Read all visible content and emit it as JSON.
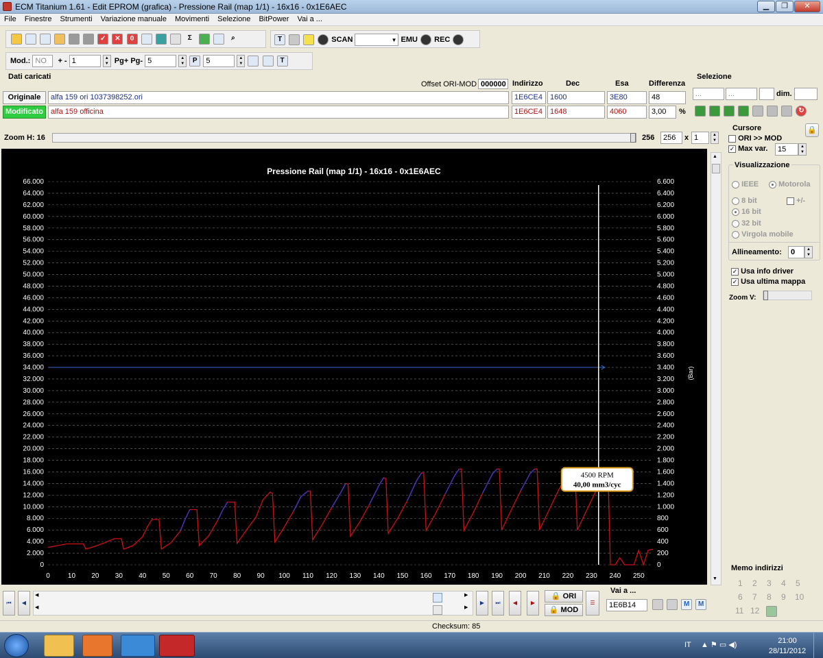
{
  "window": {
    "title": "ECM Titanium 1.61 - Edit EPROM (grafica) - Pressione Rail (map 1/1) - 16x16 - 0x1E6AEC",
    "minimize": "▁",
    "maximize": "❐",
    "close": "✕"
  },
  "menu": [
    "File",
    "Finestre",
    "Strumenti",
    "Variazione manuale",
    "Movimenti",
    "Selezione",
    "BitPower",
    "Vai a ..."
  ],
  "toolbar1": {
    "scan_label": "SCAN",
    "scan_value": "",
    "emu_label": "EMU",
    "rec_label": "REC"
  },
  "toolbar2": {
    "mod_label": "Mod.:",
    "mod_value": "NO",
    "plusminus_label": "+ -",
    "plusminus_value": "1",
    "pg_label": "Pg+ Pg-",
    "pg_value": "5",
    "p_value": "5"
  },
  "dati": {
    "header": "Dati caricati",
    "offset_label": "Offset ORI-MOD",
    "offset_value": "000000",
    "col_indirizzo": "Indirizzo",
    "col_dec": "Dec",
    "col_esa": "Esa",
    "col_diff": "Differenza",
    "originale": {
      "label": "Originale",
      "name": "alfa 159  ori 1037398252.ori",
      "indirizzo": "1E6CE4",
      "dec": "1600",
      "esa": "3E80",
      "diff": "48"
    },
    "modificato": {
      "label": "Modificato",
      "name": "alfa 159 officina",
      "indirizzo": "1E6CE4",
      "dec": "1648",
      "esa": "4060",
      "diff": "3,00",
      "pct": "%"
    }
  },
  "selezione": {
    "header": "Selezione",
    "field1": "...",
    "field2": "...",
    "dim_label": "dim."
  },
  "zoom": {
    "label": "Zoom H: 16",
    "v1": "256",
    "v2": "256",
    "x": "x",
    "mult": "1"
  },
  "cursore": {
    "header": "Cursore",
    "ori_mod": "ORI >> MOD",
    "max_var_label": "Max var.",
    "max_var_value": "15"
  },
  "visualizzazione": {
    "header": "Visualizzazione",
    "ieee": "IEEE",
    "motorola": "Motorola",
    "bit8": "8 bit",
    "plusminus": "+/-",
    "bit16": "16 bit",
    "bit32": "32 bit",
    "virgola": "Virgola mobile",
    "allineamento_label": "Allineamento:",
    "allineamento_value": "0",
    "usa_info": "Usa info driver",
    "usa_ultima": "Usa ultima mappa",
    "zoom_v": "Zoom V:"
  },
  "memo": {
    "header": "Memo indirizzi",
    "numbers": [
      "1",
      "2",
      "3",
      "4",
      "5",
      "6",
      "7",
      "8",
      "9",
      "10",
      "11",
      "12"
    ]
  },
  "bottom": {
    "ori_btn": "ORI",
    "mod_btn": "MOD",
    "vai_label": "Vai a ...",
    "vai_value": "1E6B14"
  },
  "status": {
    "checksum": "Checksum: 85"
  },
  "taskbar": {
    "lang": "IT",
    "time": "21:00",
    "date": "28/11/2012"
  },
  "chart_data": {
    "type": "line",
    "title": "Pressione Rail (map 1/1) - 16x16 - 0x1E6AEC",
    "xlabel": "",
    "ylabel_left": "",
    "ylabel_right": "(Bar)",
    "xlim": [
      0,
      256
    ],
    "ylim_left": [
      0,
      66000
    ],
    "ylim_right": [
      0,
      6600
    ],
    "xticks": [
      0,
      10,
      20,
      30,
      40,
      50,
      60,
      70,
      80,
      90,
      100,
      110,
      120,
      130,
      140,
      150,
      160,
      170,
      180,
      190,
      200,
      210,
      220,
      230,
      240,
      250
    ],
    "yticks_left": [
      "0",
      "2.000",
      "4.000",
      "6.000",
      "8.000",
      "10.000",
      "12.000",
      "14.000",
      "16.000",
      "18.000",
      "20.000",
      "22.000",
      "24.000",
      "26.000",
      "28.000",
      "30.000",
      "32.000",
      "34.000",
      "36.000",
      "38.000",
      "40.000",
      "42.000",
      "44.000",
      "46.000",
      "48.000",
      "50.000",
      "52.000",
      "54.000",
      "56.000",
      "58.000",
      "60.000",
      "62.000",
      "64.000",
      "66.000"
    ],
    "yticks_right": [
      "0",
      "200",
      "400",
      "600",
      "800",
      "1.000",
      "1.200",
      "1.400",
      "1.600",
      "1.800",
      "2.000",
      "2.200",
      "2.400",
      "2.600",
      "2.800",
      "3.000",
      "3.200",
      "3.400",
      "3.600",
      "3.800",
      "4.000",
      "4.200",
      "4.400",
      "4.600",
      "4.800",
      "5.000",
      "5.200",
      "5.400",
      "5.600",
      "5.800",
      "6.000",
      "6.200",
      "6.400",
      "6.600"
    ],
    "grid": true,
    "cursor": {
      "x": 233,
      "rpm": "4500 RPM",
      "qty": "40,00 mm3/cyc"
    },
    "hline": {
      "y": 34000
    },
    "series": [
      {
        "color": "#d01010",
        "points": [
          [
            0,
            3000
          ],
          [
            4,
            3300
          ],
          [
            8,
            3600
          ],
          [
            12,
            3600
          ],
          [
            15,
            3600
          ],
          [
            16,
            2700
          ],
          [
            20,
            3200
          ],
          [
            24,
            3800
          ],
          [
            28,
            4500
          ],
          [
            31,
            4500
          ],
          [
            32,
            2700
          ],
          [
            36,
            3300
          ],
          [
            40,
            4800
          ],
          [
            42,
            6500
          ],
          [
            44,
            7800
          ],
          [
            47,
            7800
          ],
          [
            48,
            2700
          ],
          [
            52,
            3800
          ],
          [
            56,
            5800
          ],
          [
            58,
            7800
          ],
          [
            60,
            9500
          ],
          [
            63,
            9500
          ],
          [
            64,
            3300
          ],
          [
            68,
            5000
          ],
          [
            72,
            7800
          ],
          [
            74,
            9500
          ],
          [
            76,
            10800
          ],
          [
            79,
            10800
          ],
          [
            80,
            3700
          ],
          [
            84,
            6000
          ],
          [
            88,
            8200
          ],
          [
            91,
            11200
          ],
          [
            94,
            12500
          ],
          [
            95,
            12300
          ],
          [
            96,
            3900
          ],
          [
            100,
            6500
          ],
          [
            104,
            9300
          ],
          [
            107,
            11700
          ],
          [
            110,
            12700
          ],
          [
            111,
            12700
          ],
          [
            112,
            4300
          ],
          [
            116,
            6900
          ],
          [
            120,
            9800
          ],
          [
            124,
            12500
          ],
          [
            126,
            14000
          ],
          [
            127,
            13900
          ],
          [
            128,
            4900
          ],
          [
            132,
            7400
          ],
          [
            136,
            10400
          ],
          [
            140,
            13600
          ],
          [
            142,
            15000
          ],
          [
            143,
            14800
          ],
          [
            144,
            5400
          ],
          [
            148,
            8000
          ],
          [
            152,
            11000
          ],
          [
            156,
            14500
          ],
          [
            158,
            15800
          ],
          [
            159,
            15800
          ],
          [
            160,
            5900
          ],
          [
            164,
            8800
          ],
          [
            168,
            12100
          ],
          [
            172,
            15300
          ],
          [
            174,
            16500
          ],
          [
            175,
            16500
          ],
          [
            176,
            5900
          ],
          [
            180,
            9000
          ],
          [
            184,
            12400
          ],
          [
            188,
            15600
          ],
          [
            190,
            16500
          ],
          [
            191,
            16500
          ],
          [
            192,
            6000
          ],
          [
            196,
            9400
          ],
          [
            200,
            12700
          ],
          [
            204,
            15700
          ],
          [
            206,
            16500
          ],
          [
            207,
            16500
          ],
          [
            208,
            6000
          ],
          [
            212,
            9400
          ],
          [
            216,
            12800
          ],
          [
            220,
            15700
          ],
          [
            222,
            16500
          ],
          [
            223,
            16500
          ],
          [
            224,
            6000
          ],
          [
            228,
            9400
          ],
          [
            232,
            12800
          ],
          [
            236,
            15600
          ],
          [
            237,
            16000
          ],
          [
            238,
            0
          ],
          [
            240,
            0
          ],
          [
            242,
            1200
          ],
          [
            244,
            0
          ],
          [
            248,
            0
          ],
          [
            250,
            2500
          ],
          [
            252,
            0
          ],
          [
            254,
            2500
          ],
          [
            256,
            2700
          ]
        ]
      },
      {
        "color": "#3a3ad0",
        "points": [
          [
            56,
            5800
          ],
          [
            58,
            7800
          ],
          [
            60,
            9500
          ],
          [
            72,
            7800
          ],
          [
            74,
            9500
          ],
          [
            76,
            10800
          ],
          [
            104,
            9300
          ],
          [
            107,
            11700
          ],
          [
            110,
            12700
          ],
          [
            120,
            9800
          ],
          [
            124,
            12500
          ],
          [
            126,
            14000
          ],
          [
            136,
            10400
          ],
          [
            140,
            13600
          ],
          [
            142,
            15000
          ],
          [
            152,
            11000
          ],
          [
            156,
            14500
          ],
          [
            158,
            15800
          ],
          [
            168,
            12100
          ],
          [
            172,
            15300
          ],
          [
            174,
            16500
          ],
          [
            184,
            12400
          ],
          [
            188,
            15600
          ],
          [
            190,
            16500
          ],
          [
            200,
            12700
          ],
          [
            204,
            15700
          ],
          [
            206,
            16500
          ]
        ]
      }
    ]
  }
}
